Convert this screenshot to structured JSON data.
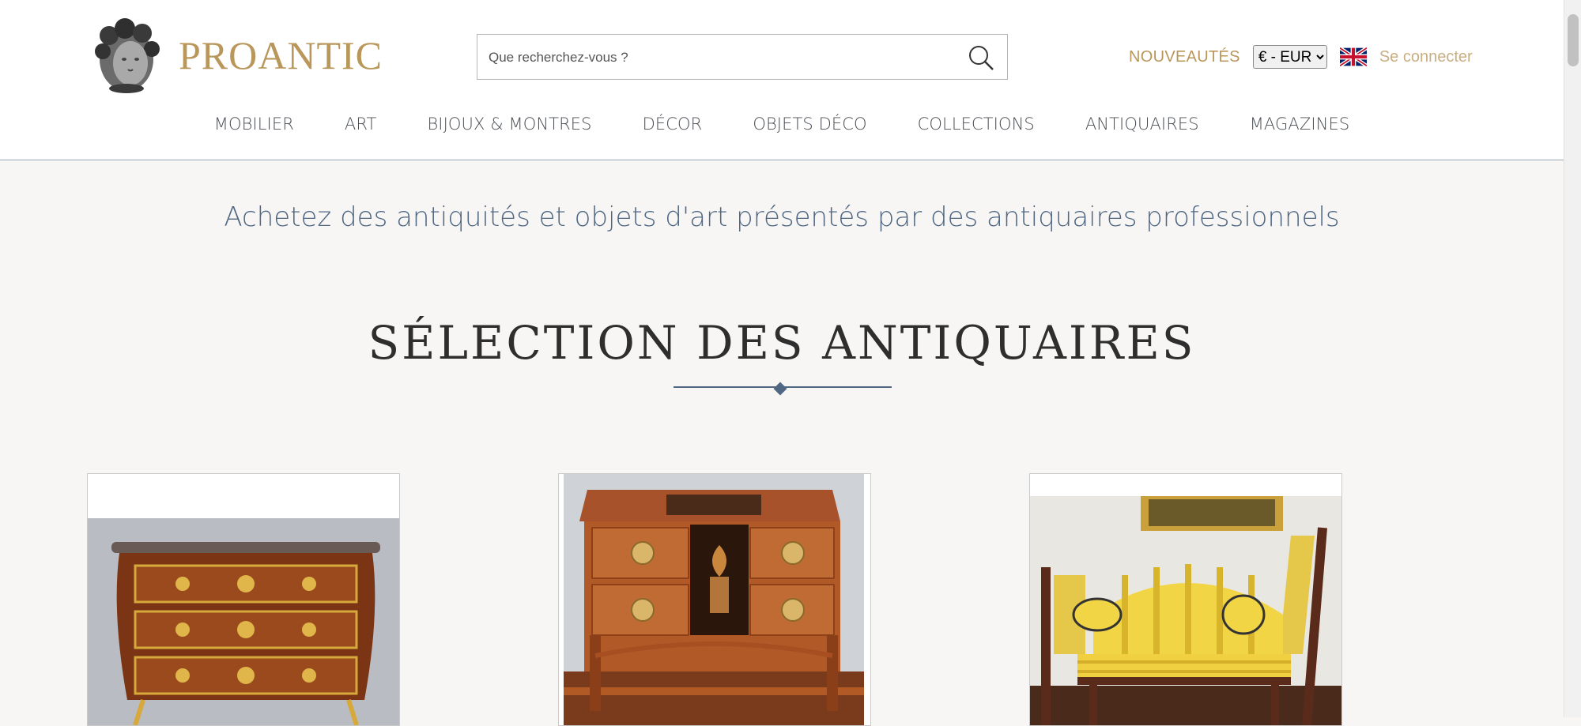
{
  "header": {
    "logo_text": "PROANTIC",
    "search": {
      "placeholder": "Que recherchez-vous ?"
    },
    "nouveautes": "NOUVEAUTÉS",
    "currency": {
      "selected": "€ - EUR"
    },
    "language_icon": "uk-flag-icon",
    "login": "Se connecter"
  },
  "nav": {
    "items": [
      "MOBILIER",
      "ART",
      "BIJOUX & MONTRES",
      "DÉCOR",
      "OBJETS DÉCO",
      "COLLECTIONS",
      "ANTIQUAIRES",
      "MAGAZINES"
    ]
  },
  "hero": {
    "tagline": "Achetez des antiquités et objets d'art présentés par des antiquaires professionnels"
  },
  "section": {
    "title": "SÉLECTION DES ANTIQUAIRES"
  },
  "cards": [
    {
      "image": "louis-xv-commode-image"
    },
    {
      "image": "marquetry-commode-image"
    },
    {
      "image": "yellow-striped-sofa-image"
    }
  ],
  "colors": {
    "brand_gold": "#b9975b",
    "accent_blue": "#4f6783",
    "background": "#f7f6f4"
  }
}
